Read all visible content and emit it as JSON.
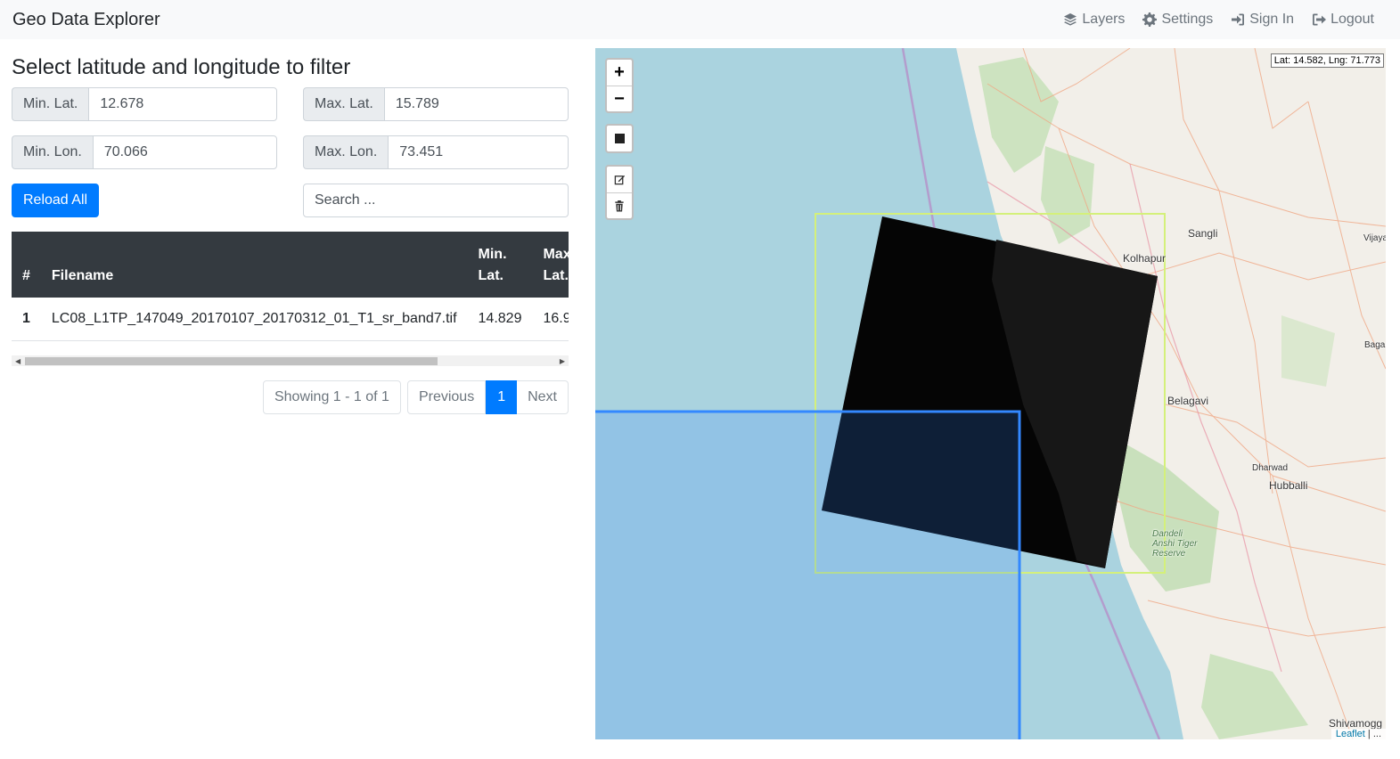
{
  "app": {
    "title": "Geo Data Explorer"
  },
  "nav": [
    {
      "label": "Layers",
      "icon": "layers-icon"
    },
    {
      "label": "Settings",
      "icon": "gear-icon"
    },
    {
      "label": "Sign In",
      "icon": "sign-in-icon"
    },
    {
      "label": "Logout",
      "icon": "logout-icon"
    }
  ],
  "filter": {
    "heading": "Select latitude and longitude to filter",
    "min_lat": {
      "label": "Min. Lat.",
      "value": "12.678"
    },
    "max_lat": {
      "label": "Max. Lat.",
      "value": "15.789"
    },
    "min_lon": {
      "label": "Min. Lon.",
      "value": "70.066"
    },
    "max_lon": {
      "label": "Max. Lon.",
      "value": "73.451"
    },
    "reload_label": "Reload All",
    "search_placeholder": "Search ..."
  },
  "table": {
    "headers": [
      "#",
      "Filename",
      "Min. Lat.",
      "Max. Lat."
    ],
    "rows": [
      {
        "idx": "1",
        "filename": "LC08_L1TP_147049_20170107_20170312_01_T1_sr_band7.tif",
        "min_lat": "14.829",
        "max_lat": "16.9"
      }
    ]
  },
  "pagination": {
    "info": "Showing 1 - 1 of 1",
    "previous": "Previous",
    "current": "1",
    "next": "Next"
  },
  "map": {
    "coord_readout": "Lat: 14.582, Lng: 71.773",
    "zoom_in": "+",
    "zoom_out": "−",
    "attribution_link": "Leaflet",
    "attribution_rest": " | ...",
    "cities": {
      "sangli": "Sangli",
      "kolhapur": "Kolhapur",
      "vijaya": "Vijaya",
      "baga": "Baga",
      "belagavi": "Belagavi",
      "dharwad": "Dharwad",
      "hubballi": "Hubballi",
      "dandeli": "Dandeli\nAnshi Tiger\nReserve",
      "shivamogga": "Shivamogg"
    },
    "colors": {
      "sea": "#aad3df",
      "land": "#f2efe9",
      "raster": "#000000",
      "selection": "#3388ff",
      "bbox": "#d4f07a"
    }
  }
}
